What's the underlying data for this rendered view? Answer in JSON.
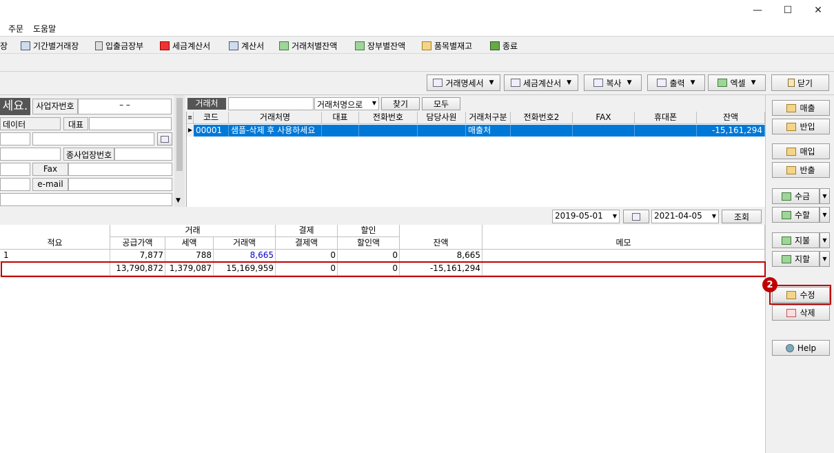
{
  "window": {
    "minimize": "—",
    "maximize": "☐",
    "close": "✕"
  },
  "menu": [
    "주문",
    "도움말"
  ],
  "toolbar": [
    {
      "label": "장",
      "icon": "ledger-icon"
    },
    {
      "label": "기간별거래장",
      "icon": "period-ledger-icon"
    },
    {
      "label": "입출금장부",
      "icon": "calculator-icon"
    },
    {
      "label": "세금계산서",
      "icon": "tax-invoice-icon"
    },
    {
      "label": "계산서",
      "icon": "invoice-icon"
    },
    {
      "label": "거래처별잔액",
      "icon": "money-icon"
    },
    {
      "label": "장부별잔액",
      "icon": "money-icon"
    },
    {
      "label": "품목별재고",
      "icon": "box-icon"
    },
    {
      "label": "종료",
      "icon": "exit-icon"
    }
  ],
  "actions": {
    "statement": "거래명세서",
    "tax_invoice": "세금계산서",
    "copy": "복사",
    "print": "출력",
    "excel": "엑셀",
    "close": "닫기"
  },
  "left": {
    "big_label": "세요.",
    "biz_no_label": "사업자번호",
    "biz_no_value": "–     –",
    "data_label": "데이터",
    "rep_label": "대표",
    "sub_biz_label": "종사업장번호",
    "fax_label": "Fax",
    "email_label": "e-mail"
  },
  "search": {
    "label": "거래처",
    "mode": "거래처명으로",
    "find": "찾기",
    "all": "모두"
  },
  "grid1": {
    "headers": [
      "코드",
      "거래처명",
      "대표",
      "전화번호",
      "담당사원",
      "거래처구분",
      "전화번호2",
      "FAX",
      "휴대폰",
      "잔액"
    ],
    "row": [
      "00001",
      "샘플-삭제 후 사용하세요",
      "",
      "",
      "",
      "매출처",
      "",
      "",
      "",
      "-15,161,294"
    ]
  },
  "filter": {
    "date_from": "2019-05-01",
    "date_to": "2021-04-05",
    "query": "조회"
  },
  "grid2": {
    "group_headers": {
      "trade": "거래",
      "payment": "결제",
      "discount": "할인"
    },
    "headers": [
      "적요",
      "공급가액",
      "세액",
      "거래액",
      "결제액",
      "할인액",
      "잔액",
      "메모"
    ],
    "rows": [
      [
        "1",
        "7,877",
        "788",
        "8,665",
        "0",
        "0",
        "8,665",
        ""
      ],
      [
        "",
        "13,790,872",
        "1,379,087",
        "15,169,959",
        "0",
        "0",
        "-15,161,294",
        ""
      ]
    ]
  },
  "side": {
    "sale": "매출",
    "sale_return": "반입",
    "purchase": "매입",
    "purchase_return": "반출",
    "receipt": "수금",
    "receipt_discount": "수할",
    "payment": "지불",
    "payment_discount": "지할",
    "edit": "수정",
    "delete": "삭제",
    "help": "Help"
  },
  "annotation": {
    "badge": "2"
  },
  "colors": {
    "selection": "#0078d7",
    "highlight": "#c00000"
  }
}
